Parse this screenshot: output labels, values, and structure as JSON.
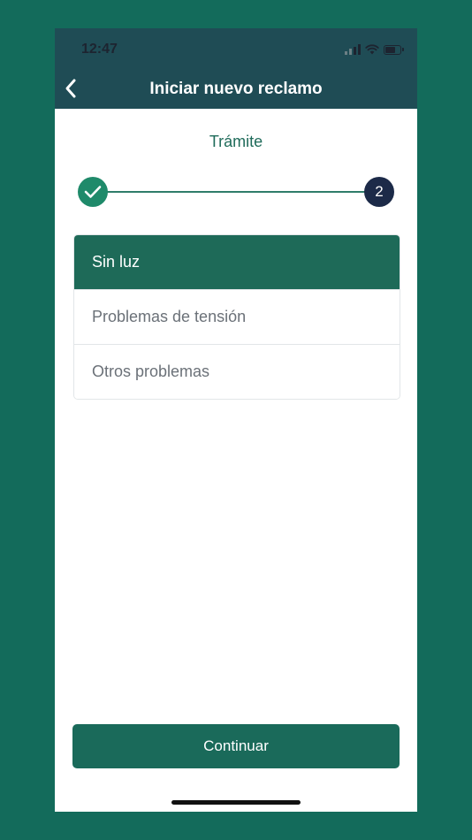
{
  "status_bar": {
    "time": "12:47",
    "icons": [
      "signal-icon",
      "wifi-icon",
      "battery-icon"
    ]
  },
  "nav": {
    "back_icon": "chevron-left-icon",
    "title": "Iniciar nuevo reclamo"
  },
  "section": {
    "title": "Trámite"
  },
  "stepper": {
    "completed_icon": "check-icon",
    "current_step": "2"
  },
  "options": [
    {
      "label": "Sin luz",
      "selected": true
    },
    {
      "label": "Problemas de tensión",
      "selected": false
    },
    {
      "label": "Otros problemas",
      "selected": false
    }
  ],
  "footer": {
    "continue_label": "Continuar"
  },
  "colors": {
    "background": "#136b5b",
    "header": "#1f4c55",
    "accent": "#1e6a58",
    "step_done": "#1f8a6a",
    "step_current": "#1c2a48"
  }
}
